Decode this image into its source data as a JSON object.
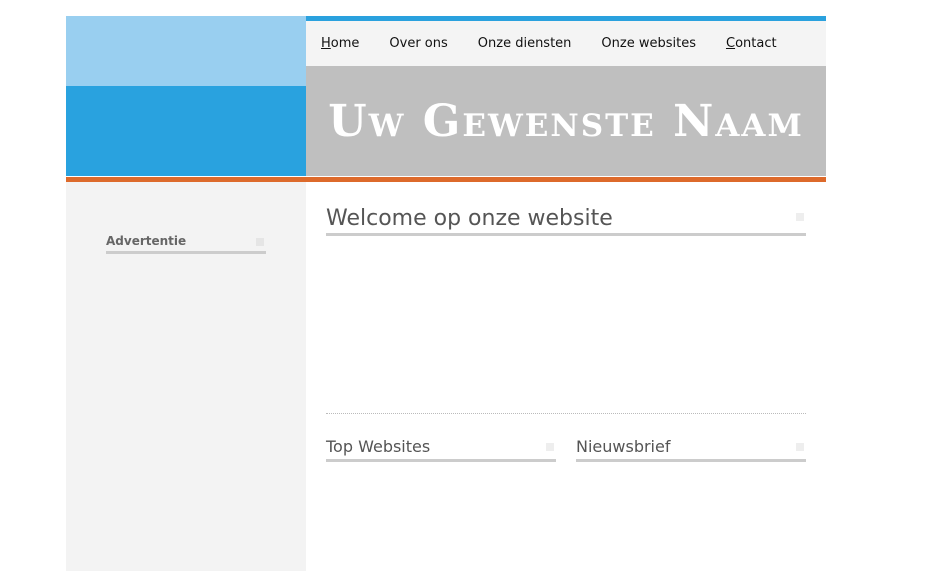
{
  "nav": {
    "items": [
      {
        "label": "Home",
        "underline_first": true
      },
      {
        "label": "Over ons",
        "underline_first": false
      },
      {
        "label": "Onze diensten",
        "underline_first": false
      },
      {
        "label": "Onze websites",
        "underline_first": false
      },
      {
        "label": "Contact",
        "underline_first": true
      }
    ]
  },
  "banner": {
    "title": "Uw Gewenste Naam"
  },
  "sidebar": {
    "advertentie_heading": "Advertentie"
  },
  "main": {
    "welcome_heading": "Welcome op onze website",
    "top_websites_heading": "Top Websites",
    "nieuwsbrief_heading": "Nieuwsbrief"
  },
  "colors": {
    "blue_light": "#99cff0",
    "blue_dark": "#29a2df",
    "banner_gray": "#bfbfbf",
    "accent_orange": "#dd6a2b",
    "sidebar_bg": "#f3f3f3"
  },
  "icons": {
    "heading_decoration": "plus-grid-icon"
  }
}
